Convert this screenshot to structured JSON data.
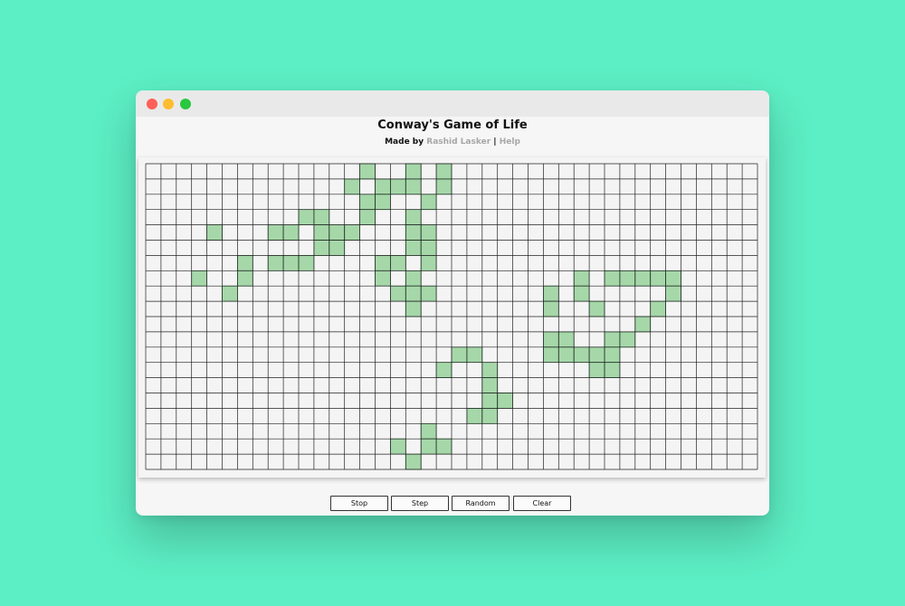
{
  "window": {
    "title": "Conway's Game of Life",
    "byline_prefix": "Made by",
    "author_link": "Rashid Lasker",
    "separator": "|",
    "help_link": "Help"
  },
  "board": {
    "cols": 40,
    "rows": 20,
    "live_color": "#a6d7a9",
    "live_stroke": "#3f7a4b",
    "line_color": "#222222",
    "live_cells": [
      [
        14,
        0
      ],
      [
        17,
        0
      ],
      [
        19,
        0
      ],
      [
        13,
        1
      ],
      [
        15,
        1
      ],
      [
        16,
        1
      ],
      [
        17,
        1
      ],
      [
        19,
        1
      ],
      [
        14,
        2
      ],
      [
        15,
        2
      ],
      [
        18,
        2
      ],
      [
        10,
        3
      ],
      [
        11,
        3
      ],
      [
        14,
        3
      ],
      [
        17,
        3
      ],
      [
        8,
        4
      ],
      [
        9,
        4
      ],
      [
        11,
        4
      ],
      [
        12,
        4
      ],
      [
        13,
        4
      ],
      [
        17,
        4
      ],
      [
        18,
        4
      ],
      [
        4,
        4
      ],
      [
        11,
        5
      ],
      [
        12,
        5
      ],
      [
        17,
        5
      ],
      [
        18,
        5
      ],
      [
        6,
        6
      ],
      [
        8,
        6
      ],
      [
        9,
        6
      ],
      [
        10,
        6
      ],
      [
        15,
        6
      ],
      [
        16,
        6
      ],
      [
        18,
        6
      ],
      [
        3,
        7
      ],
      [
        6,
        7
      ],
      [
        15,
        7
      ],
      [
        17,
        7
      ],
      [
        28,
        7
      ],
      [
        30,
        7
      ],
      [
        31,
        7
      ],
      [
        32,
        7
      ],
      [
        33,
        7
      ],
      [
        34,
        7
      ],
      [
        5,
        8
      ],
      [
        16,
        8
      ],
      [
        17,
        8
      ],
      [
        18,
        8
      ],
      [
        26,
        8
      ],
      [
        28,
        8
      ],
      [
        34,
        8
      ],
      [
        17,
        9
      ],
      [
        26,
        9
      ],
      [
        29,
        9
      ],
      [
        33,
        9
      ],
      [
        32,
        10
      ],
      [
        26,
        11
      ],
      [
        27,
        11
      ],
      [
        30,
        11
      ],
      [
        31,
        11
      ],
      [
        20,
        12
      ],
      [
        21,
        12
      ],
      [
        26,
        12
      ],
      [
        27,
        12
      ],
      [
        28,
        12
      ],
      [
        29,
        12
      ],
      [
        30,
        12
      ],
      [
        19,
        13
      ],
      [
        22,
        13
      ],
      [
        29,
        13
      ],
      [
        30,
        13
      ],
      [
        22,
        14
      ],
      [
        22,
        15
      ],
      [
        23,
        15
      ],
      [
        21,
        16
      ],
      [
        22,
        16
      ],
      [
        18,
        17
      ],
      [
        16,
        18
      ],
      [
        18,
        18
      ],
      [
        19,
        18
      ],
      [
        17,
        19
      ]
    ]
  },
  "controls": {
    "stop": "Stop",
    "step": "Step",
    "random": "Random",
    "clear": "Clear"
  }
}
